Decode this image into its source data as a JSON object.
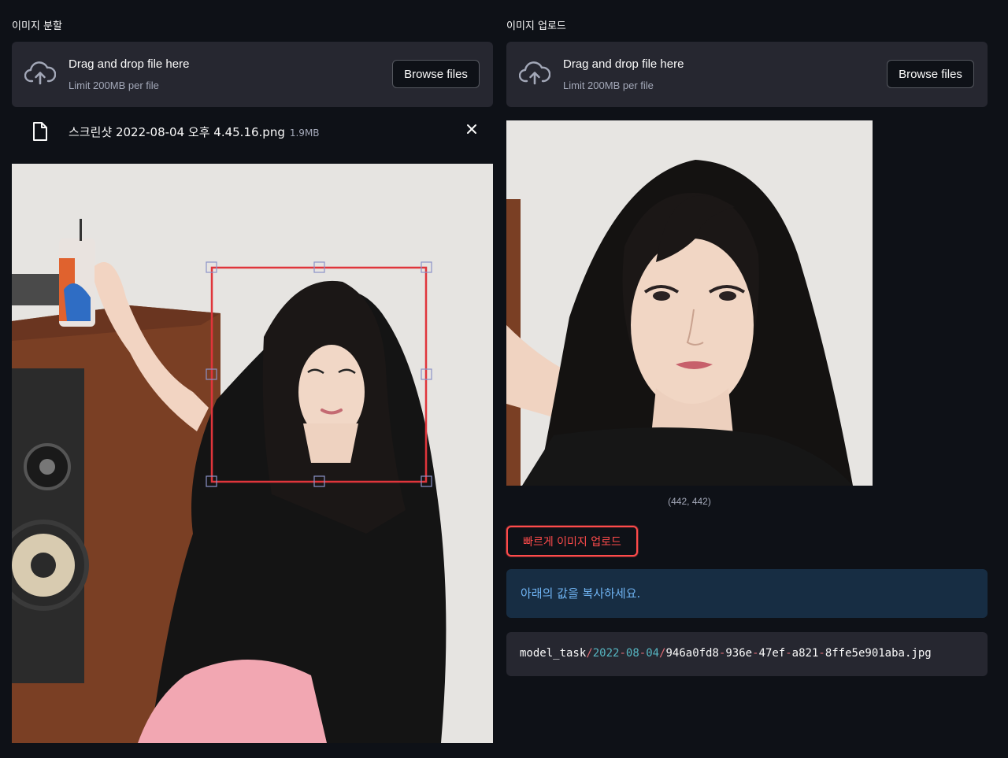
{
  "left": {
    "label": "이미지 분할",
    "uploader": {
      "title": "Drag and drop file here",
      "subtitle": "Limit 200MB per file",
      "browse_label": "Browse files",
      "icon": "cloud-upload-icon"
    },
    "file": {
      "name": "스크린샷 2022-08-04 오후 4.45.16.png",
      "size": "1.9MB",
      "icon": "file-icon",
      "remove_icon": "close-icon"
    }
  },
  "right": {
    "label": "이미지 업로드",
    "uploader": {
      "title": "Drag and drop file here",
      "subtitle": "Limit 200MB per file",
      "browse_label": "Browse files",
      "icon": "cloud-upload-icon"
    },
    "crop_caption": "(442, 442)",
    "quick_upload_label": "빠르게 이미지 업로드",
    "info_text": "아래의 값을 복사하세요.",
    "code": {
      "part1": "model_task",
      "sep1": "/",
      "part2": "2022",
      "dash1": "-",
      "part3": "08",
      "dash2": "-",
      "part4": "04",
      "sep2": "/",
      "part5": "946a0fd8",
      "dash3": "-",
      "part6": "936e",
      "dash4": "-",
      "part7": "47ef",
      "dash5": "-",
      "part8": "a821",
      "dash6": "-",
      "part9": "8ffe5e901aba.jpg"
    }
  },
  "colors": {
    "background": "#0e1117",
    "panel": "#262730",
    "accent_red": "#ff4b4b",
    "info_bg": "#172d43",
    "info_text": "#6fb3f2"
  }
}
